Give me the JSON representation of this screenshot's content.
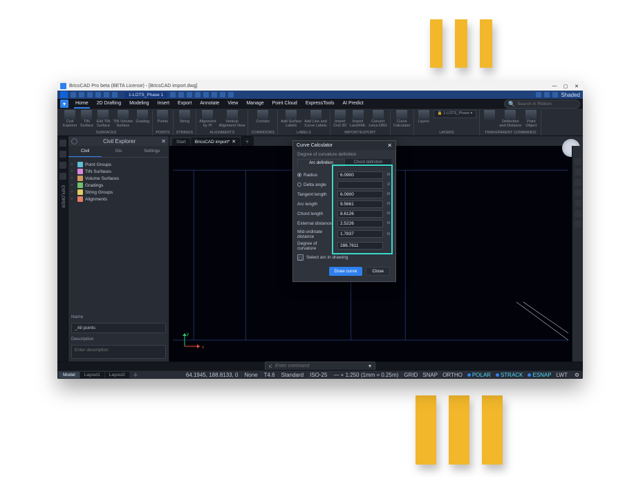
{
  "titlebar": {
    "title": "BricsCAD Pro beta (BETA License) - [BricsCAD import.dwg]"
  },
  "qat": {
    "file_tab": "1-LOTS_Phase 1",
    "display_mode": "Shaded"
  },
  "menu": {
    "items": [
      "Home",
      "2D Drafting",
      "Modeling",
      "Insert",
      "Export",
      "Annotate",
      "View",
      "Manage",
      "Point Cloud",
      "ExpressTools",
      "AI Predict"
    ],
    "search_placeholder": "Search in Ribbon"
  },
  "ribbon": {
    "groups": [
      {
        "name": "SURFACES",
        "items": [
          "Civil\nExplorer",
          "TIN\nSurface",
          "Edit TIN\nSurface",
          "TIN Volume\nSurface",
          "Grading"
        ]
      },
      {
        "name": "POINTS",
        "items": [
          "Points"
        ]
      },
      {
        "name": "STRINGS",
        "items": [
          "String"
        ]
      },
      {
        "name": "ALIGNMENTS",
        "items": [
          "Alignment\nby PI",
          "Vertical\nAlignment View"
        ]
      },
      {
        "name": "CORRIDORS",
        "items": [
          "Corridor"
        ]
      },
      {
        "name": "LABELS",
        "items": [
          "Add Surface\nLabels",
          "Add Line and\nCurve Labels"
        ]
      },
      {
        "name": "IMPORT/EXPORT",
        "items": [
          "Import\nCivil 3D",
          "Import\nLandXML",
          "Convert\nLeica DBG"
        ]
      },
      {
        "name": "",
        "items": [
          "Curve\nCalculator"
        ]
      },
      {
        "name": "LAYERS",
        "items": [
          "Layers"
        ],
        "extra": "1-LOTS_Phase"
      },
      {
        "name": "TRANSPARENT COMMANDS",
        "items": [
          "",
          "Deflection\nand Distance",
          "Point\nObject"
        ]
      }
    ]
  },
  "explorer": {
    "title": "Civil Explorer",
    "tabs": [
      "Civil",
      "Gis",
      "Settings"
    ],
    "tree": [
      {
        "label": "Point Groups",
        "color": "#5ec0d6"
      },
      {
        "label": "TIN Surfaces",
        "color": "#d98bd8"
      },
      {
        "label": "Volume Surfaces",
        "color": "#d0995a"
      },
      {
        "label": "Gradings",
        "color": "#6fc26b"
      },
      {
        "label": "String Groups",
        "color": "#e0cd60"
      },
      {
        "label": "Alignments",
        "color": "#e17f62"
      }
    ],
    "name_label": "Name",
    "name_value": "_All points",
    "desc_label": "Description",
    "desc_placeholder": "Enter description"
  },
  "doc_tabs": {
    "tabs": [
      {
        "label": "Start",
        "closable": false
      },
      {
        "label": "BricsCAD import*",
        "closable": true
      }
    ]
  },
  "dialog": {
    "title": "Curve Calculator",
    "subtitle": "Degree of curvature definition",
    "tabs": [
      "Arc definition",
      "Chord definition"
    ],
    "fields": [
      {
        "label": "Radius",
        "radio": true,
        "checked": true,
        "value": "6.0900",
        "unit": "m"
      },
      {
        "label": "Delta angle",
        "radio": true,
        "checked": false,
        "value": "",
        "unit": "d",
        "disabled": true
      },
      {
        "label": "Tangent length",
        "value": "6.0900",
        "unit": "m"
      },
      {
        "label": "Arc length",
        "value": "9.5661",
        "unit": "m"
      },
      {
        "label": "Chord length",
        "value": "8.6126",
        "unit": "m"
      },
      {
        "label": "External distance",
        "value": "2.5226",
        "unit": "m"
      },
      {
        "label": "Mid-ordinate distance",
        "value": "1.7837",
        "unit": "m"
      },
      {
        "label": "Degree of curvature",
        "value": "286.7611",
        "unit": ""
      }
    ],
    "select_label": "Select arc in drawing",
    "primary": "Draw curve",
    "secondary": "Close"
  },
  "layouts": {
    "tabs": [
      "Model",
      "Layout1",
      "Layout2"
    ]
  },
  "command": {
    "placeholder": "Enter command"
  },
  "status": {
    "left": [
      "64.1945, 188.8133, 0",
      "None",
      "T4.6",
      "Standard",
      "ISO-25"
    ],
    "scale": "1:250 (1mm = 0.25m)",
    "toggles": [
      {
        "label": "GRID",
        "on": false
      },
      {
        "label": "SNAP",
        "on": false
      },
      {
        "label": "ORTHO",
        "on": false
      },
      {
        "label": "POLAR",
        "on": true
      },
      {
        "label": "STRACK",
        "on": true
      },
      {
        "label": "ESNAP",
        "on": true
      },
      {
        "label": "LWT",
        "on": false
      }
    ]
  }
}
